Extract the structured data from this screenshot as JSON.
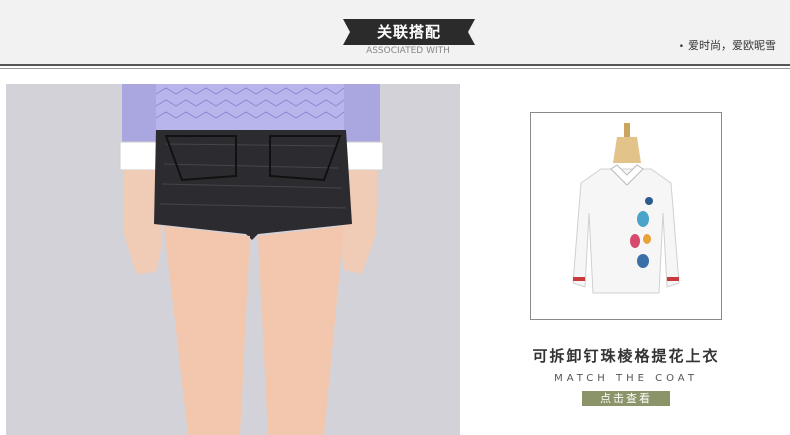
{
  "section_header": {
    "title": "关联搭配",
    "subtitle": "ASSOCIATED WITH",
    "brand_slogan": "爱时尚，爱欧昵雪",
    "slogan_dot": "•"
  },
  "main_photo": {
    "alt": "model-wearing-dark-tweed-shorts"
  },
  "product": {
    "name": "可拆卸钉珠棱格提花上衣",
    "tagline": "MATCH THE COAT",
    "cta_label": "点击查看"
  },
  "colors": {
    "header_bg": "#f2f2f2",
    "title_box_bg": "#2b2b2b",
    "cta_bg": "#8b9368",
    "photo_bg": "#d3d2d8"
  }
}
